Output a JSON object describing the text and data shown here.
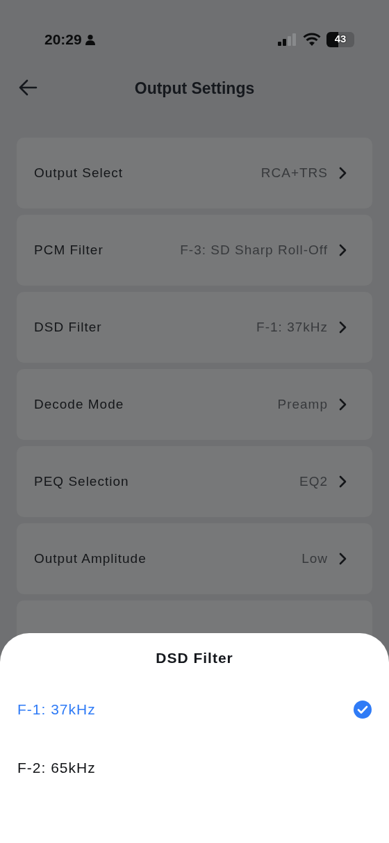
{
  "status_bar": {
    "time": "20:29",
    "battery": {
      "text": "43",
      "level": 0.43
    }
  },
  "header": {
    "title": "Output Settings"
  },
  "settings": [
    {
      "label": "Output Select",
      "value": "RCA+TRS"
    },
    {
      "label": "PCM Filter",
      "value": "F-3: SD Sharp Roll-Off"
    },
    {
      "label": "DSD Filter",
      "value": "F-1: 37kHz"
    },
    {
      "label": "Decode Mode",
      "value": "Preamp"
    },
    {
      "label": "PEQ Selection",
      "value": "EQ2"
    },
    {
      "label": "Output Amplitude",
      "value": "Low"
    },
    {
      "kind": "covered"
    }
  ],
  "sheet": {
    "title": "DSD Filter",
    "options": [
      {
        "label": "F-1: 37kHz",
        "selected": true
      },
      {
        "label": "F-2: 65kHz",
        "selected": false
      }
    ]
  }
}
